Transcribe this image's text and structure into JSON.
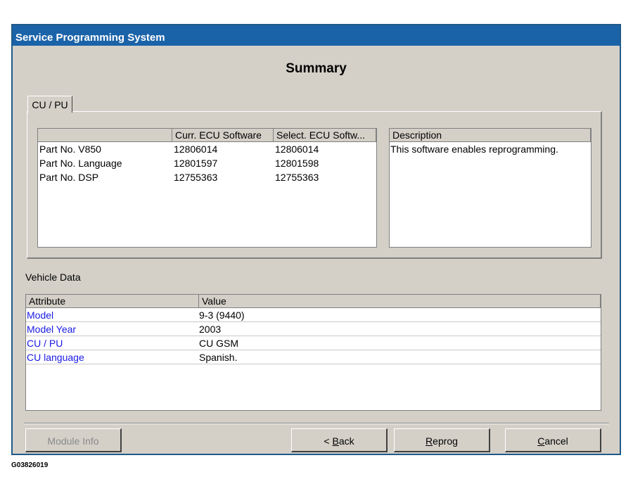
{
  "window": {
    "title": "Service Programming System",
    "heading": "Summary"
  },
  "tab": {
    "label": "CU / PU"
  },
  "software_table": {
    "columns": [
      "",
      "Curr. ECU Software",
      "Select. ECU Softw..."
    ],
    "rows": [
      [
        "Part No. V850",
        "12806014",
        "12806014"
      ],
      [
        "Part No. Language",
        "12801597",
        "12801598"
      ],
      [
        "Part No. DSP",
        "12755363",
        "12755363"
      ]
    ]
  },
  "description": {
    "header": "Description",
    "text": "This software enables reprogramming."
  },
  "vehicle_data": {
    "label": "Vehicle Data",
    "columns": [
      "Attribute",
      "Value"
    ],
    "rows": [
      [
        "Model",
        "9-3 (9440)"
      ],
      [
        "Model Year",
        "2003"
      ],
      [
        "CU / PU",
        "CU GSM"
      ],
      [
        "CU language",
        "Spanish."
      ]
    ],
    "attribute_color": "#1a1ae6"
  },
  "buttons": {
    "module_info": "Module Info",
    "back_prefix": "< ",
    "back_key": "B",
    "back_rest": "ack",
    "reprog_key": "R",
    "reprog_rest": "eprog",
    "cancel_key": "C",
    "cancel_rest": "ancel"
  },
  "caption": "G03826019",
  "colors": {
    "titlebar": "#1b63a8",
    "window_bg": "#d4d0c8"
  }
}
